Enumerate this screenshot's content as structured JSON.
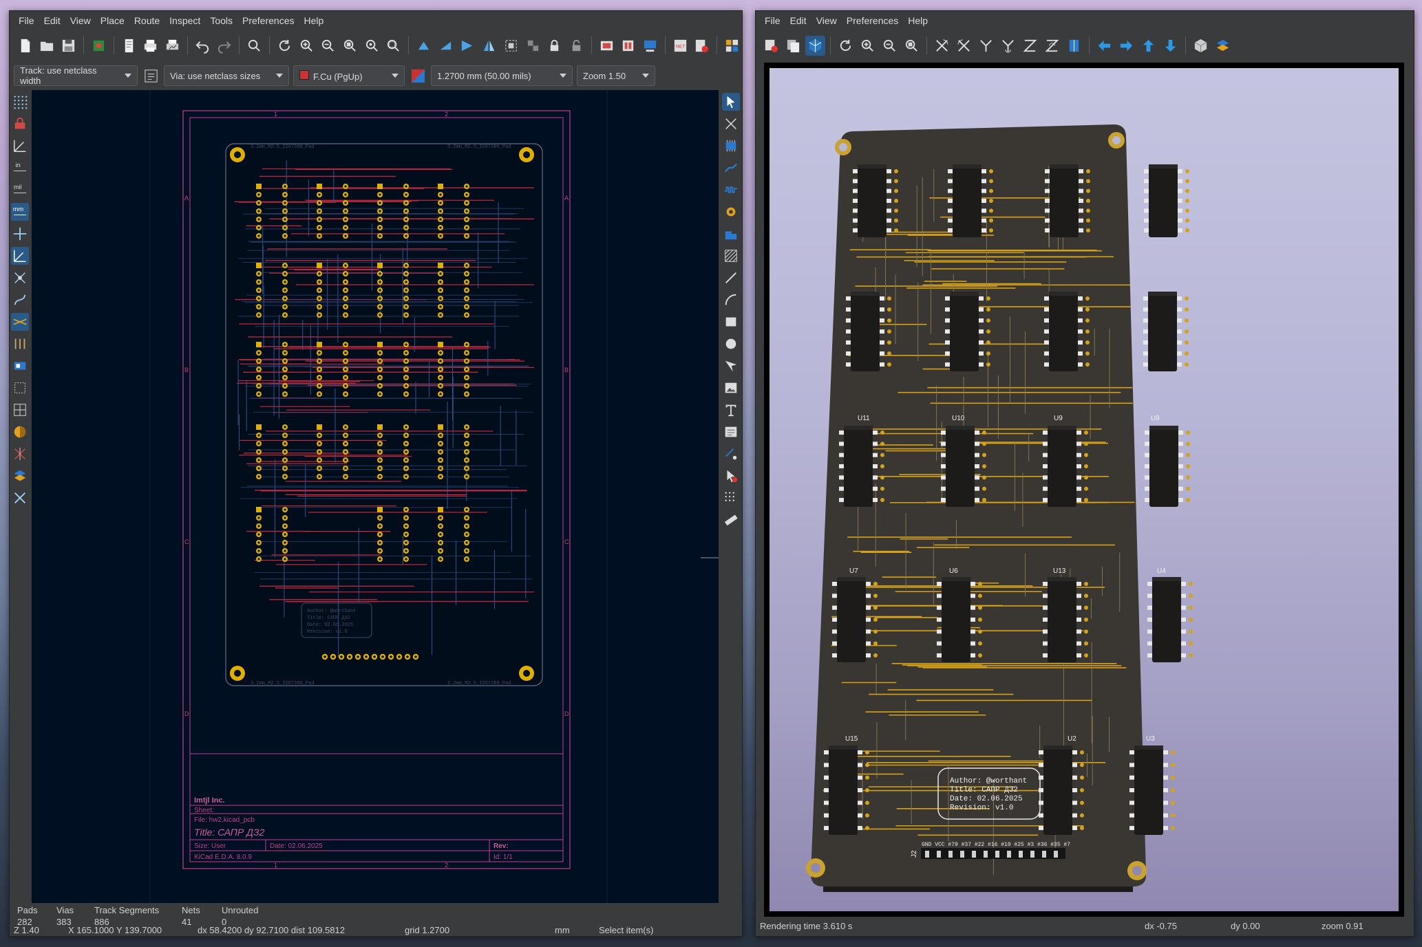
{
  "pcb_editor": {
    "menu": [
      "File",
      "Edit",
      "View",
      "Place",
      "Route",
      "Inspect",
      "Tools",
      "Preferences",
      "Help"
    ],
    "options": {
      "track": "Track: use netclass width",
      "via": "Via: use netclass sizes",
      "layer": "F.Cu (PgUp)",
      "layer_color": "#c83434",
      "grid": "1.2700 mm (50.00 mils)",
      "zoom": "Zoom 1.50"
    },
    "left_tools": [
      "grid-dots-icon",
      "net-inspector-icon",
      "polar-coords-icon",
      "units-inch-icon",
      "units-mil-icon",
      "units-mm-icon",
      "cursor-cross-icon",
      "angle-snap-icon",
      "ratsnest-icon",
      "curved-ratsnest-icon",
      "zones-icon",
      "vias-icon",
      "pads-icon",
      "text-icon",
      "tracks-icon",
      "high-contrast-icon",
      "appearance-icon",
      "properties-icon"
    ],
    "sheet": {
      "company": "Imtjl Inc.",
      "sheet_label": "Sheet:",
      "file": "File: hw2.kicad_pcb",
      "title": "Title: САПР ДЗ2",
      "size": "Size: User",
      "date": "Date: 02.06.2025",
      "rev": "Rev:",
      "kicad": "KiCad E.D.A. 8.0.9",
      "id": "Id: 1/1",
      "cols_top": [
        "1",
        "2"
      ],
      "rows": [
        "A",
        "B",
        "C",
        "D"
      ]
    },
    "silk_note": [
      "Author: @worthant",
      "Title: САПР ДЗ2",
      "Date: 02.06.2025",
      "Revision: v1.0"
    ],
    "hole_label": "3.2mm_M2.5_ISO7380_Pad",
    "status": {
      "pads_label": "Pads",
      "pads_val": "282",
      "vias_label": "Vias",
      "vias_val": "383",
      "tracks_label": "Track Segments",
      "tracks_val": "886",
      "nets_label": "Nets",
      "nets_val": "41",
      "unrouted_label": "Unrouted",
      "unrouted_val": "0",
      "z": "Z 1.40",
      "xy": "X 165.1000  Y 139.7000",
      "dxy": "dx 58.4200  dy 92.7100  dist 109.5812",
      "grid": "grid 1.2700",
      "units": "mm",
      "mode": "Select item(s)"
    }
  },
  "viewer_3d": {
    "menu": [
      "File",
      "Edit",
      "View",
      "Preferences",
      "Help"
    ],
    "refs": [
      "U15",
      "U2",
      "U3",
      "U7",
      "U6",
      "U13",
      "U4",
      "U11",
      "U10",
      "U9",
      "U8",
      "J2"
    ],
    "header_label": "GND VCC #79 #37 #22 #16 #10 #25 #3 #36 #35 #7",
    "silk_note": [
      "Author: @worthant",
      "Title: САПР ДЗ2",
      "Date: 02.06.2025",
      "Revision: v1.0"
    ],
    "status": {
      "render": "Rendering time 3.610 s",
      "dx": "dx -0.75",
      "dy": "dy 0.00",
      "zoom": "zoom 0.91"
    }
  }
}
